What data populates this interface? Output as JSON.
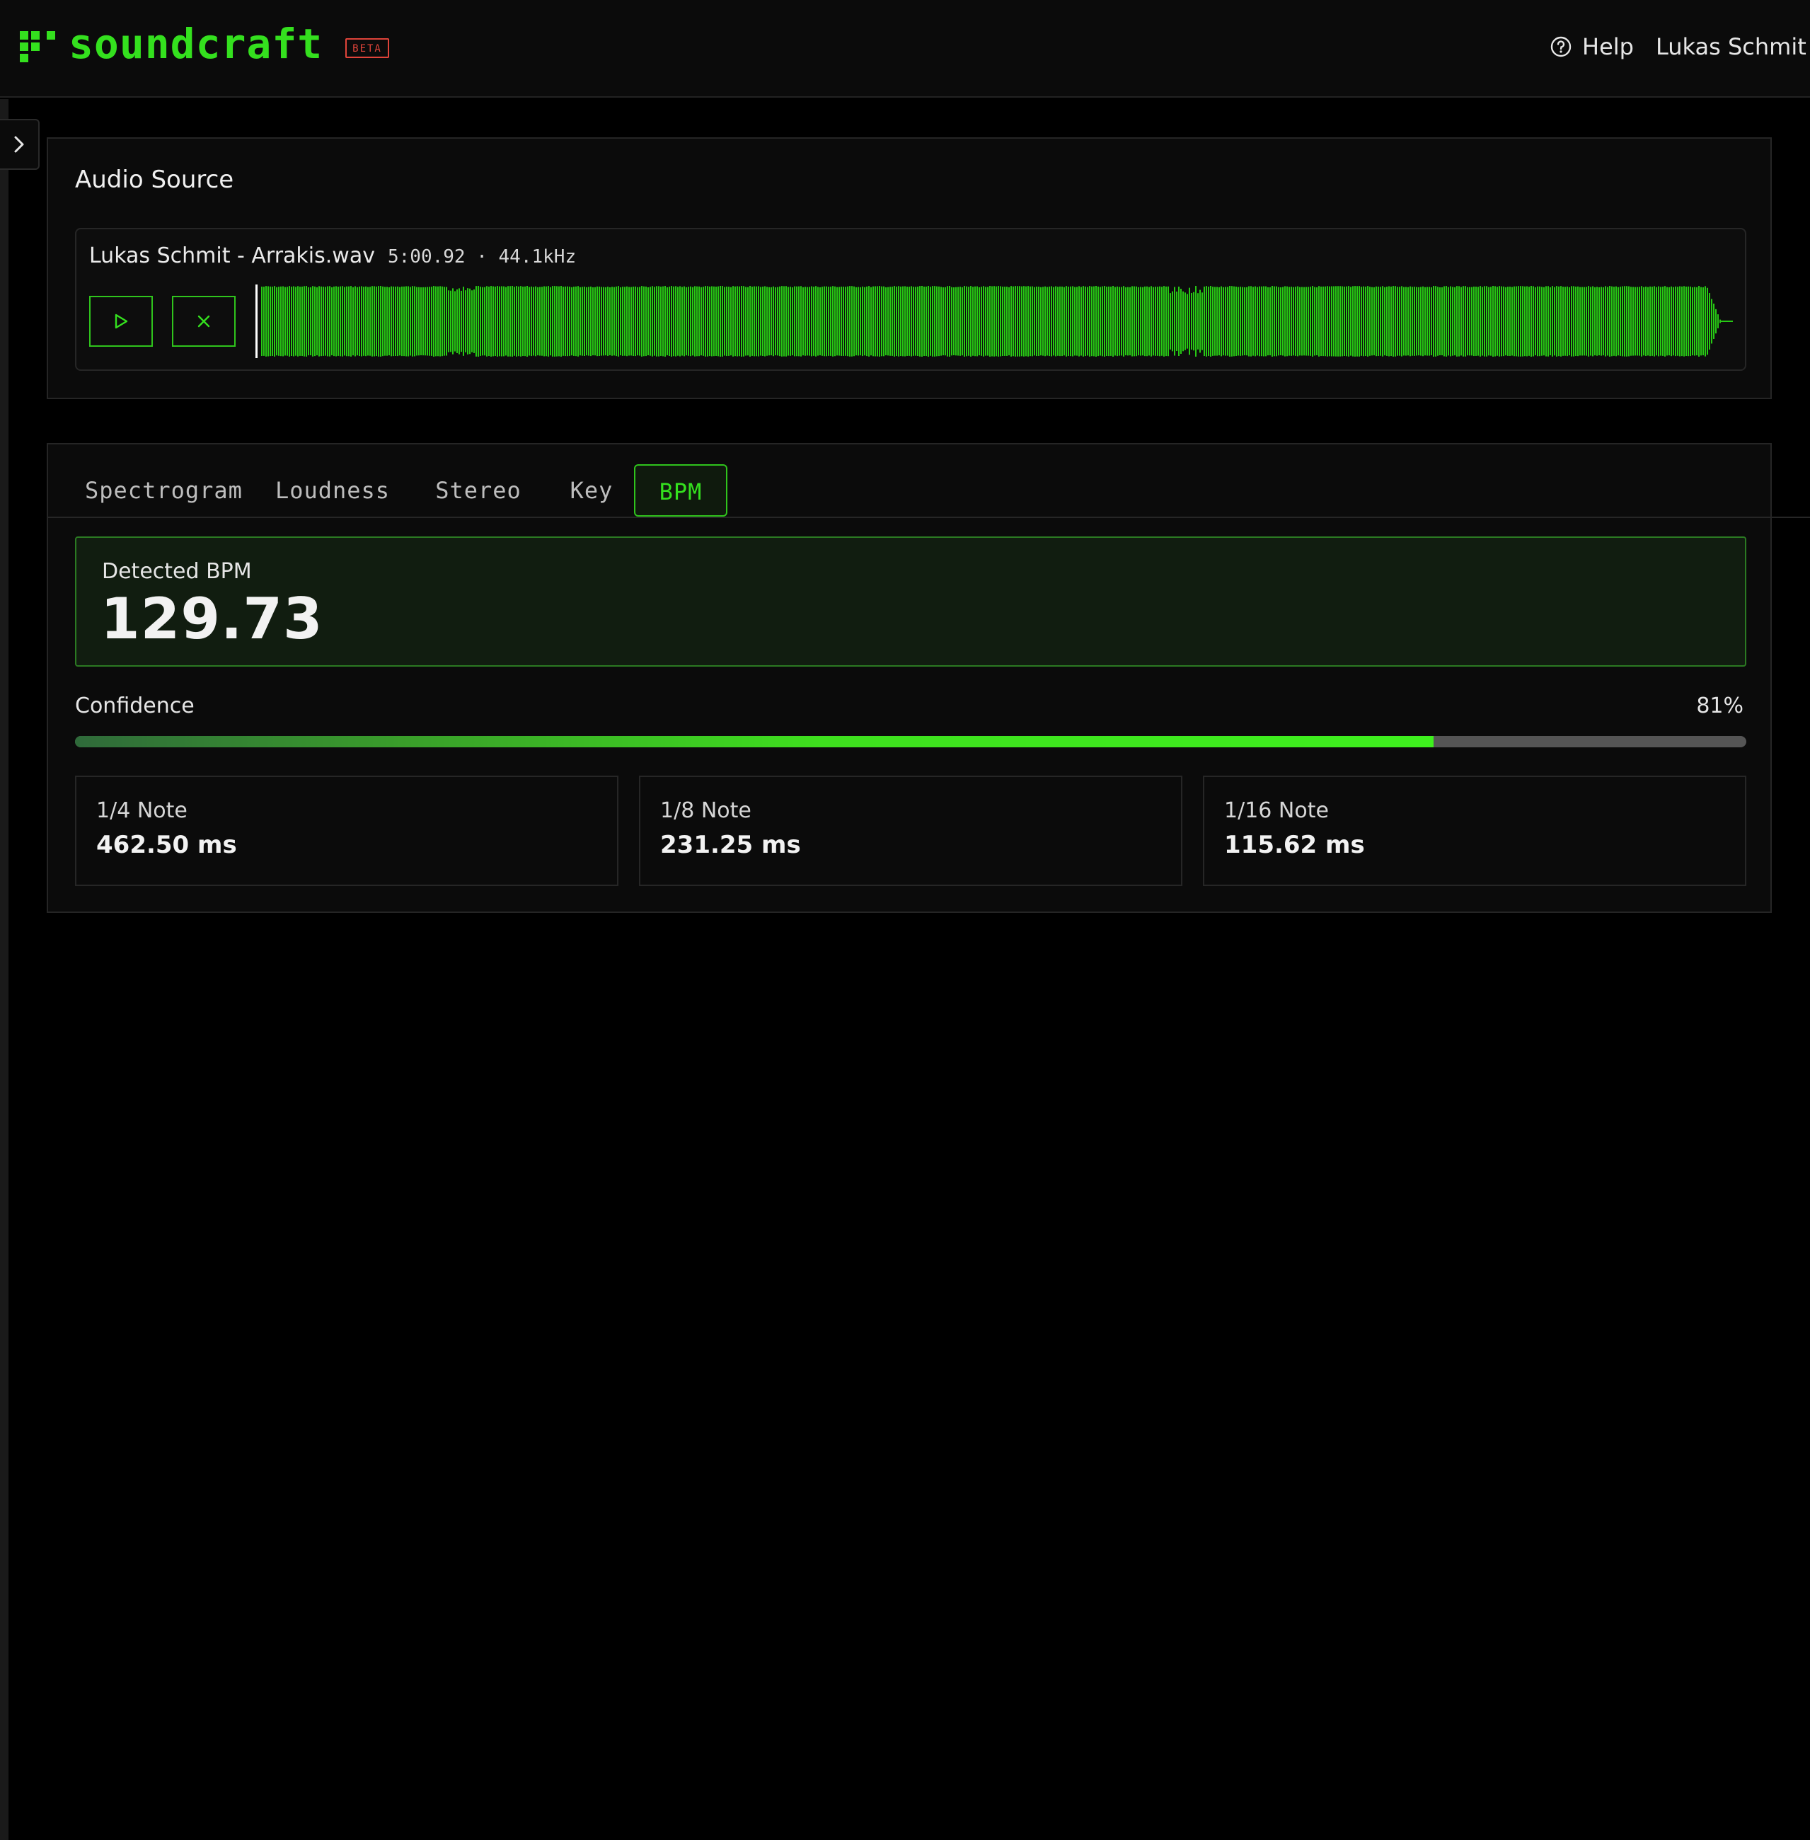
{
  "header": {
    "brand": "soundcraft",
    "badge": "BETA",
    "help_label": "Help",
    "user_name": "Lukas Schmit"
  },
  "audio_source": {
    "title": "Audio Source",
    "file_name": "Lukas Schmit - Arrakis.wav",
    "meta": "5:00.92 · 44.1kHz"
  },
  "tabs": [
    {
      "label": "Spectrogram",
      "active": false
    },
    {
      "label": "Loudness",
      "active": false
    },
    {
      "label": "Stereo",
      "active": false
    },
    {
      "label": "Key",
      "active": false
    },
    {
      "label": "BPM",
      "active": true
    }
  ],
  "bpm": {
    "label": "Detected BPM",
    "value": "129.73"
  },
  "confidence": {
    "label": "Confidence",
    "value_text": "81%",
    "fraction": 0.813
  },
  "notes": [
    {
      "label": "1/4 Note",
      "value": "462.50 ms"
    },
    {
      "label": "1/8 Note",
      "value": "231.25 ms"
    },
    {
      "label": "1/16 Note",
      "value": "115.62 ms"
    }
  ],
  "icons": {
    "play": "play-icon",
    "close": "close-icon",
    "help": "help-circle-icon",
    "chevron": "chevron-right-icon"
  },
  "colors": {
    "accent": "#34e01e",
    "badge": "#e0443a",
    "background": "#000000",
    "panel": "#0b0b0b"
  }
}
